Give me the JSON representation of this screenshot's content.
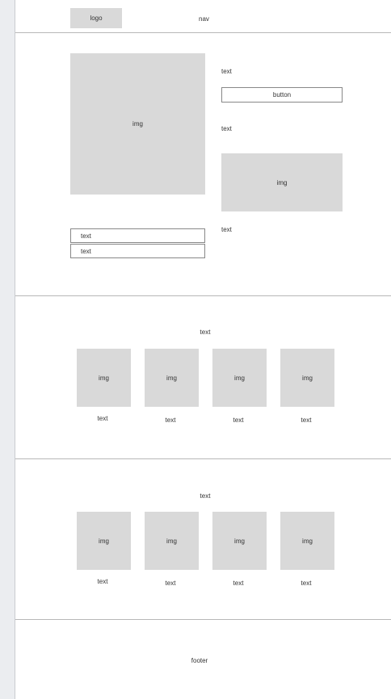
{
  "header": {
    "logo_label": "logo",
    "nav_label": "nav"
  },
  "hero": {
    "main_img_label": "img",
    "text_1": "text",
    "button_label": "button",
    "text_2": "text",
    "side_img_label": "img",
    "text_3": "text",
    "list_items": [
      "text",
      "text"
    ]
  },
  "gallery_1": {
    "heading": "text",
    "items": [
      {
        "img_label": "img",
        "caption": "text"
      },
      {
        "img_label": "img",
        "caption": "text"
      },
      {
        "img_label": "img",
        "caption": "text"
      },
      {
        "img_label": "img",
        "caption": "text"
      }
    ]
  },
  "gallery_2": {
    "heading": "text",
    "items": [
      {
        "img_label": "img",
        "caption": "text"
      },
      {
        "img_label": "img",
        "caption": "text"
      },
      {
        "img_label": "img",
        "caption": "text"
      },
      {
        "img_label": "img",
        "caption": "text"
      }
    ]
  },
  "footer": {
    "label": "footer"
  }
}
